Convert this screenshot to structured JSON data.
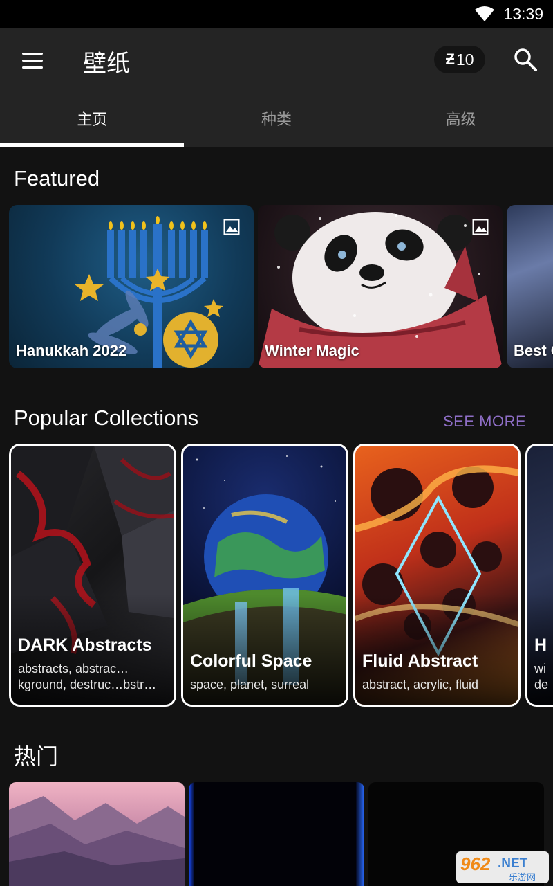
{
  "status_bar": {
    "time": "13:39",
    "wifi_icon": "wifi-icon"
  },
  "app_bar": {
    "menu_icon": "menu-icon",
    "title": "壁纸",
    "coin_symbol": "Ƶ",
    "coin_count": "10",
    "search_icon": "search-icon"
  },
  "tabs": [
    {
      "label": "主页",
      "active": true
    },
    {
      "label": "种类",
      "active": false
    },
    {
      "label": "高级",
      "active": false
    }
  ],
  "featured": {
    "title": "Featured",
    "cards": [
      {
        "label": "Hanukkah 2022",
        "badge_icon": "image-icon"
      },
      {
        "label": "Winter Magic",
        "badge_icon": "image-icon"
      },
      {
        "label": "Best C"
      }
    ]
  },
  "collections": {
    "title": "Popular Collections",
    "see_more": "SEE MORE",
    "cards": [
      {
        "title": "DARK Abstracts",
        "tags_line1": "abstracts, abstrac…",
        "tags_line2": "kground, destruc…bstr…"
      },
      {
        "title": "Colorful Space",
        "tags": "space, planet, surreal"
      },
      {
        "title": "Fluid Abstract",
        "tags": "abstract, acrylic, fluid"
      },
      {
        "title": "H",
        "tags_line1": "wi",
        "tags_line2": "de"
      }
    ]
  },
  "hot": {
    "title": "热门"
  },
  "watermark": {
    "text_962": "962",
    "text_net": ".NET",
    "text_cn": "乐游网"
  }
}
